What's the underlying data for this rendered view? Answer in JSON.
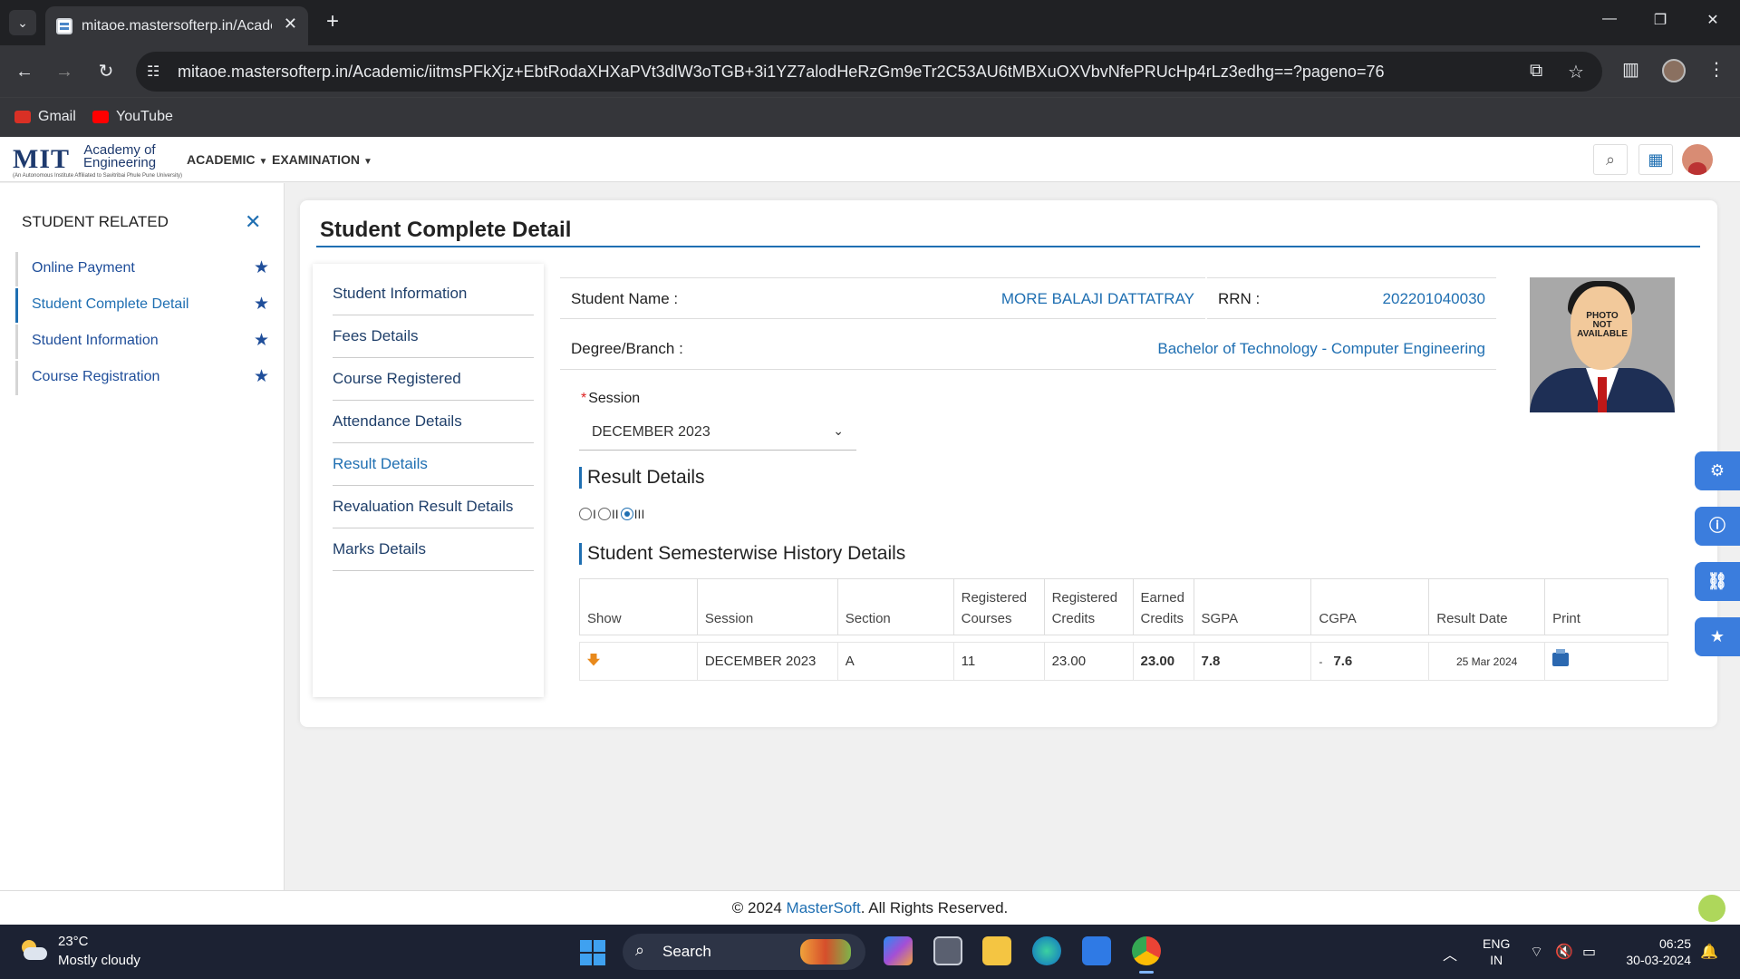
{
  "browser": {
    "tab_title": "mitaoe.mastersofterp.in/Academ",
    "url": "mitaoe.mastersofterp.in/Academic/iitmsPFkXjz+EbtRodaXHXaPVt3dlW3oTGB+3i1YZ7alodHeRzGm9eTr2C53AU6tMBXuOXVbvNfePRUcHp4rLz3edhg==?pageno=76",
    "bookmarks": [
      {
        "label": "Gmail",
        "icon": "gmail-icon",
        "color": "#d93025"
      },
      {
        "label": "YouTube",
        "icon": "youtube-icon",
        "color": "#ff0000"
      }
    ]
  },
  "header": {
    "logo_main": "MIT",
    "logo_sub_1": "Academy of",
    "logo_sub_2": "Engineering",
    "logo_tagline": "(An Autonomous Institute Affiliated to Savitribai Phule Pune University)",
    "menu": [
      {
        "label": "ACADEMIC"
      },
      {
        "label": "EXAMINATION"
      }
    ]
  },
  "sidebar": {
    "title": "STUDENT RELATED",
    "items": [
      {
        "label": "Online Payment"
      },
      {
        "label": "Student Complete Detail"
      },
      {
        "label": "Student Information"
      },
      {
        "label": "Course Registration"
      }
    ]
  },
  "main": {
    "title": "Student Complete Detail",
    "menu": [
      {
        "label": "Student Information"
      },
      {
        "label": "Fees Details"
      },
      {
        "label": "Course Registered"
      },
      {
        "label": "Attendance Details"
      },
      {
        "label": "Result Details"
      },
      {
        "label": "Revaluation Result Details"
      },
      {
        "label": "Marks Details"
      }
    ],
    "student_name_label": "Student Name :",
    "student_name": "MORE BALAJI DATTATRAY",
    "rrn_label": "RRN :",
    "rrn": "202201040030",
    "degree_label": "Degree/Branch :",
    "degree": "Bachelor of Technology - Computer Engineering",
    "photo_text_1": "PHOTO",
    "photo_text_2": "NOT",
    "photo_text_3": "AVAILABLE",
    "session_label": "Session",
    "session_value": "DECEMBER 2023",
    "result_heading": "Result Details",
    "radio_options": [
      "I",
      "II",
      "III"
    ],
    "radio_selected": "III",
    "history_heading": "Student Semesterwise History Details",
    "table": {
      "headers": {
        "show": "Show",
        "session": "Session",
        "section": "Section",
        "reg_courses_1": "Registered",
        "reg_courses_2": "Courses",
        "reg_credits_1": "Registered",
        "reg_credits_2": "Credits",
        "earned_1": "Earned",
        "earned_2": "Credits",
        "sgpa": "SGPA",
        "cgpa": "CGPA",
        "result_date": "Result Date",
        "print": "Print"
      },
      "rows": [
        {
          "session": "DECEMBER 2023",
          "section": "A",
          "registered_courses": "11",
          "registered_credits": "23.00",
          "earned_credits": "23.00",
          "sgpa": "7.8",
          "cgpa_prefix": "-",
          "cgpa": "7.6",
          "result_date": "25 Mar 2024"
        }
      ]
    }
  },
  "footer": {
    "prefix": "© 2024 ",
    "link": "MasterSoft",
    "suffix": ". All Rights Reserved."
  },
  "taskbar": {
    "temperature": "23°C",
    "weather": "Mostly cloudy",
    "search_placeholder": "Search",
    "lang_1": "ENG",
    "lang_2": "IN",
    "time": "06:25",
    "date": "30-03-2024"
  },
  "colors": {
    "accent": "#1f6fb2",
    "float_buttons": "#3b7ddd",
    "taskbar": "#1c2233"
  }
}
